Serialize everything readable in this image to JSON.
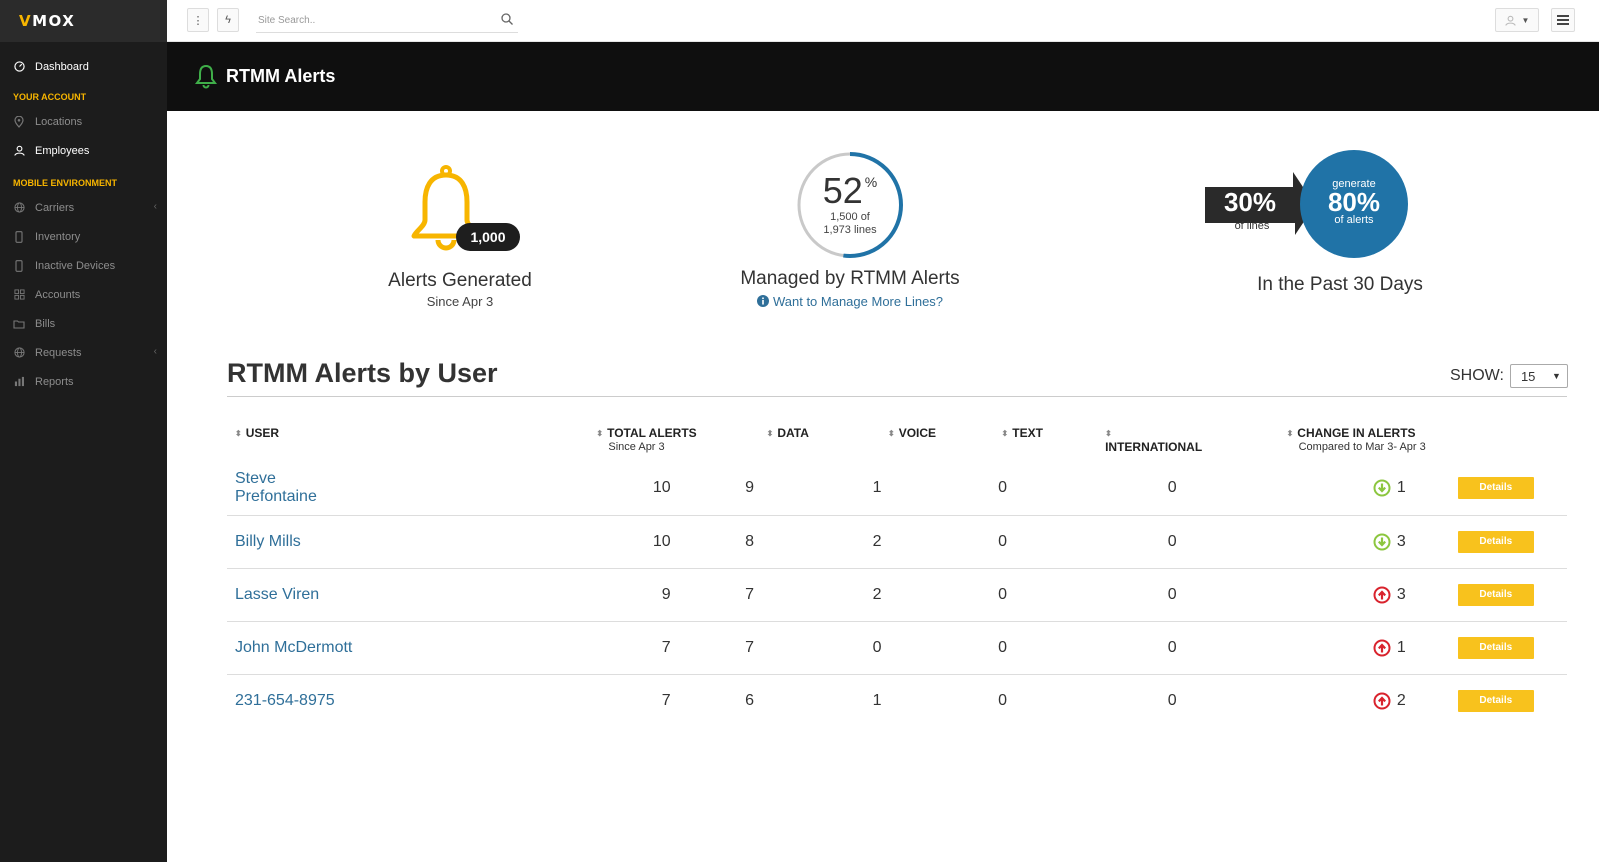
{
  "brand": {
    "logo": "MOX",
    "logo_prefix": "V"
  },
  "sidebar": {
    "dashboard": "Dashboard",
    "section_account": "YOUR ACCOUNT",
    "locations": "Locations",
    "employees": "Employees",
    "section_mobile": "MOBILE ENVIRONMENT",
    "carriers": "Carriers",
    "inventory": "Inventory",
    "inactive_devices": "Inactive Devices",
    "accounts": "Accounts",
    "bills": "Bills",
    "requests": "Requests",
    "reports": "Reports"
  },
  "topbar": {
    "search_placeholder": "Site Search.."
  },
  "header": {
    "title": "RTMM Alerts"
  },
  "summary": {
    "alerts": {
      "count": "1,000",
      "label": "Alerts Generated",
      "since": "Since Apr 3"
    },
    "managed": {
      "percent": "52",
      "percent_sign": "%",
      "percent_value": 52,
      "line1": "1,500 of",
      "line2": "1,973 lines",
      "label": "Managed by RTMM Alerts",
      "link": "Want to Manage More Lines?"
    },
    "ratio": {
      "lines_pct": "30%",
      "lines_label": "of lines",
      "gen_label": "generate",
      "alerts_pct": "80%",
      "alerts_label": "of alerts",
      "period": "In the Past 30 Days"
    }
  },
  "table": {
    "title": "RTMM Alerts by User",
    "show_label": "SHOW:",
    "show_value": "15",
    "columns": {
      "user": "USER",
      "total": "TOTAL ALERTS",
      "total_sub": "Since Apr 3",
      "data": "DATA",
      "voice": "VOICE",
      "text": "TEXT",
      "international": "INTERNATIONAL",
      "change": "CHANGE IN ALERTS",
      "change_sub": "Compared to Mar 3- Apr 3"
    },
    "details_label": "Details",
    "rows": [
      {
        "user": "Steve Prefontaine",
        "total": "10",
        "data": "9",
        "voice": "1",
        "text": "0",
        "international": "0",
        "change": "1",
        "direction": "down"
      },
      {
        "user": "Billy Mills",
        "total": "10",
        "data": "8",
        "voice": "2",
        "text": "0",
        "international": "0",
        "change": "3",
        "direction": "down"
      },
      {
        "user": "Lasse Viren",
        "total": "9",
        "data": "7",
        "voice": "2",
        "text": "0",
        "international": "0",
        "change": "3",
        "direction": "up"
      },
      {
        "user": "John McDermott",
        "total": "7",
        "data": "7",
        "voice": "0",
        "text": "0",
        "international": "0",
        "change": "1",
        "direction": "up"
      },
      {
        "user": "231-654-8975",
        "total": "7",
        "data": "6",
        "voice": "1",
        "text": "0",
        "international": "0",
        "change": "2",
        "direction": "up"
      }
    ]
  },
  "colors": {
    "accent": "#f7b500",
    "link": "#2f6f99",
    "down": "#8cc63f",
    "up": "#d9232d",
    "circle": "#2073a7"
  }
}
